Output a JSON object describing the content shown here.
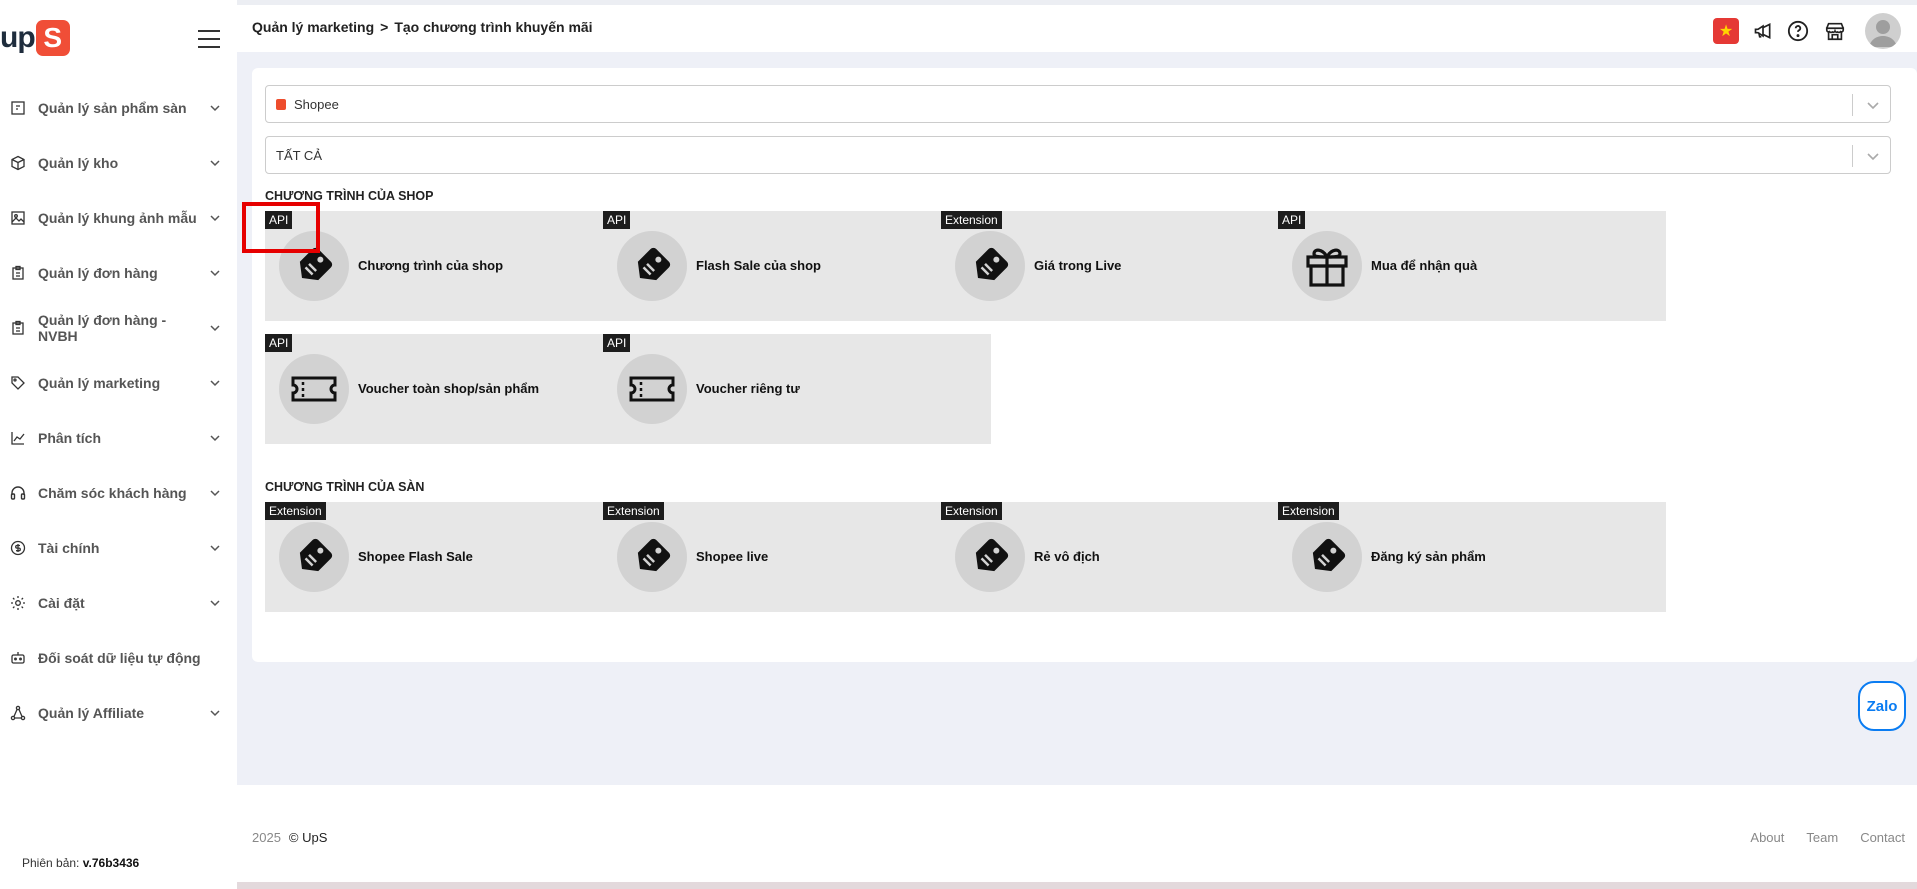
{
  "brand": {
    "logo_text": "up",
    "logo_mark": "S",
    "accent": "#f04e37"
  },
  "sidebar": {
    "items": [
      {
        "label": "Quản lý sản phẩm sàn",
        "icon": "product-box-icon",
        "has_chevron": true
      },
      {
        "label": "Quản lý kho",
        "icon": "warehouse-cube-icon",
        "has_chevron": true
      },
      {
        "label": "Quản lý khung ảnh mẫu",
        "icon": "image-frame-icon",
        "has_chevron": true
      },
      {
        "label": "Quản lý đơn hàng",
        "icon": "clipboard-icon",
        "has_chevron": true
      },
      {
        "label": "Quản lý đơn hàng - NVBH",
        "icon": "clipboard-icon",
        "has_chevron": true
      },
      {
        "label": "Quản lý marketing",
        "icon": "tag-icon",
        "has_chevron": true
      },
      {
        "label": "Phân tích",
        "icon": "line-chart-icon",
        "has_chevron": true
      },
      {
        "label": "Chăm sóc khách hàng",
        "icon": "headset-icon",
        "has_chevron": true
      },
      {
        "label": "Tài chính",
        "icon": "dollar-circle-icon",
        "has_chevron": true
      },
      {
        "label": "Cài đặt",
        "icon": "gear-icon",
        "has_chevron": true
      },
      {
        "label": "Đối soát dữ liệu tự động",
        "icon": "robot-icon",
        "has_chevron": false
      },
      {
        "label": "Quản lý Affiliate",
        "icon": "network-icon",
        "has_chevron": true
      }
    ],
    "version_label": "Phiên bản:",
    "version_value": "v.76b3436"
  },
  "header": {
    "breadcrumb": [
      "Quản lý marketing",
      "Tạo chương trình khuyến mãi"
    ],
    "breadcrumb_sep": ">",
    "icons": [
      "vietnam-flag-icon",
      "megaphone-icon",
      "help-circle-icon",
      "store-icon",
      "user-avatar-icon"
    ]
  },
  "filters": {
    "platform": "Shopee",
    "type": "TẤT CẢ"
  },
  "sections": [
    {
      "title": "CHƯƠNG TRÌNH CỦA SHOP",
      "cards": [
        {
          "badge": "API",
          "name": "Chương trình của shop",
          "icon": "tag-icon"
        },
        {
          "badge": "API",
          "name": "Flash Sale của shop",
          "icon": "tag-icon"
        },
        {
          "badge": "Extension",
          "name": "Giá trong Live",
          "icon": "tag-icon"
        },
        {
          "badge": "API",
          "name": "Mua để nhận quà",
          "icon": "gift-icon"
        },
        {
          "badge": "API",
          "name": "Voucher toàn shop/sản phẩm",
          "icon": "ticket-icon"
        },
        {
          "badge": "API",
          "name": "Voucher riêng tư",
          "icon": "ticket-icon"
        }
      ]
    },
    {
      "title": "CHƯƠNG TRÌNH CỦA SÀN",
      "cards": [
        {
          "badge": "Extension",
          "name": "Shopee Flash Sale",
          "icon": "tag-icon"
        },
        {
          "badge": "Extension",
          "name": "Shopee live",
          "icon": "tag-icon"
        },
        {
          "badge": "Extension",
          "name": "Rẻ vô địch",
          "icon": "tag-icon"
        },
        {
          "badge": "Extension",
          "name": "Đăng ký sản phẩm",
          "icon": "tag-icon"
        }
      ]
    }
  ],
  "zalo_label": "Zalo",
  "footer": {
    "year": "2025",
    "copyright": "© UpS",
    "links": [
      "About",
      "Team",
      "Contact"
    ]
  }
}
